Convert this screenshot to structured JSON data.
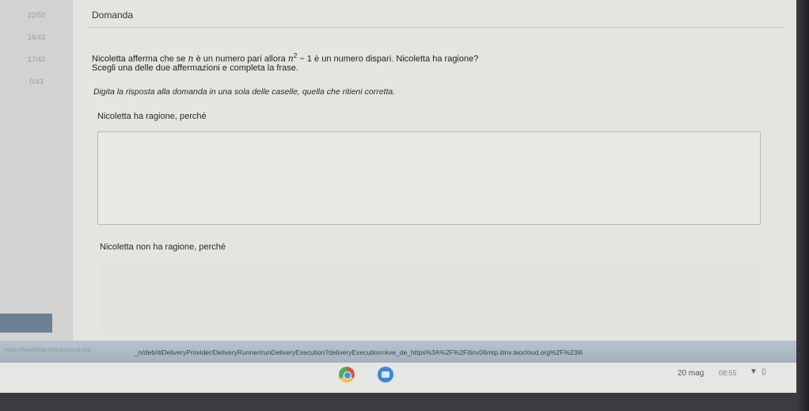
{
  "nav": {
    "items": [
      {
        "label": "22/50"
      },
      {
        "label": "16/43"
      },
      {
        "label": "17/43"
      },
      {
        "label": "0/43"
      }
    ]
  },
  "question": {
    "header": "Domanda",
    "line1_pre": "Nicoletta afferma che se ",
    "var_n": "n",
    "line1_mid": " è un numero pari allora ",
    "expr_n": "n",
    "expr_exp": "2",
    "expr_rest": " − 1",
    "line1_post": " è un numero dispari. Nicoletta ha ragione?",
    "line2": "Scegli una delle due affermazioni e completa la frase.",
    "instruction": "Digita la risposta alla domanda in una sola delle caselle, quella che ritieni corretta.",
    "choice1": "Nicoletta ha ragione, perché",
    "choice2": "Nicoletta non ha ragione, perché"
  },
  "browser": {
    "url": "_n/deb/itiDeliveryProvider/DeliveryRunner/runDeliveryExecution?deliveryExecution=kve_de_https%3A%2F%2Fitinv06mtp.itinv.taocloud.org%2F%23i6",
    "url_ghost": "https://itinv06mtp.itinv.taocloud.org/"
  },
  "taskbar": {
    "date": "20 mag",
    "time": "08:55"
  }
}
